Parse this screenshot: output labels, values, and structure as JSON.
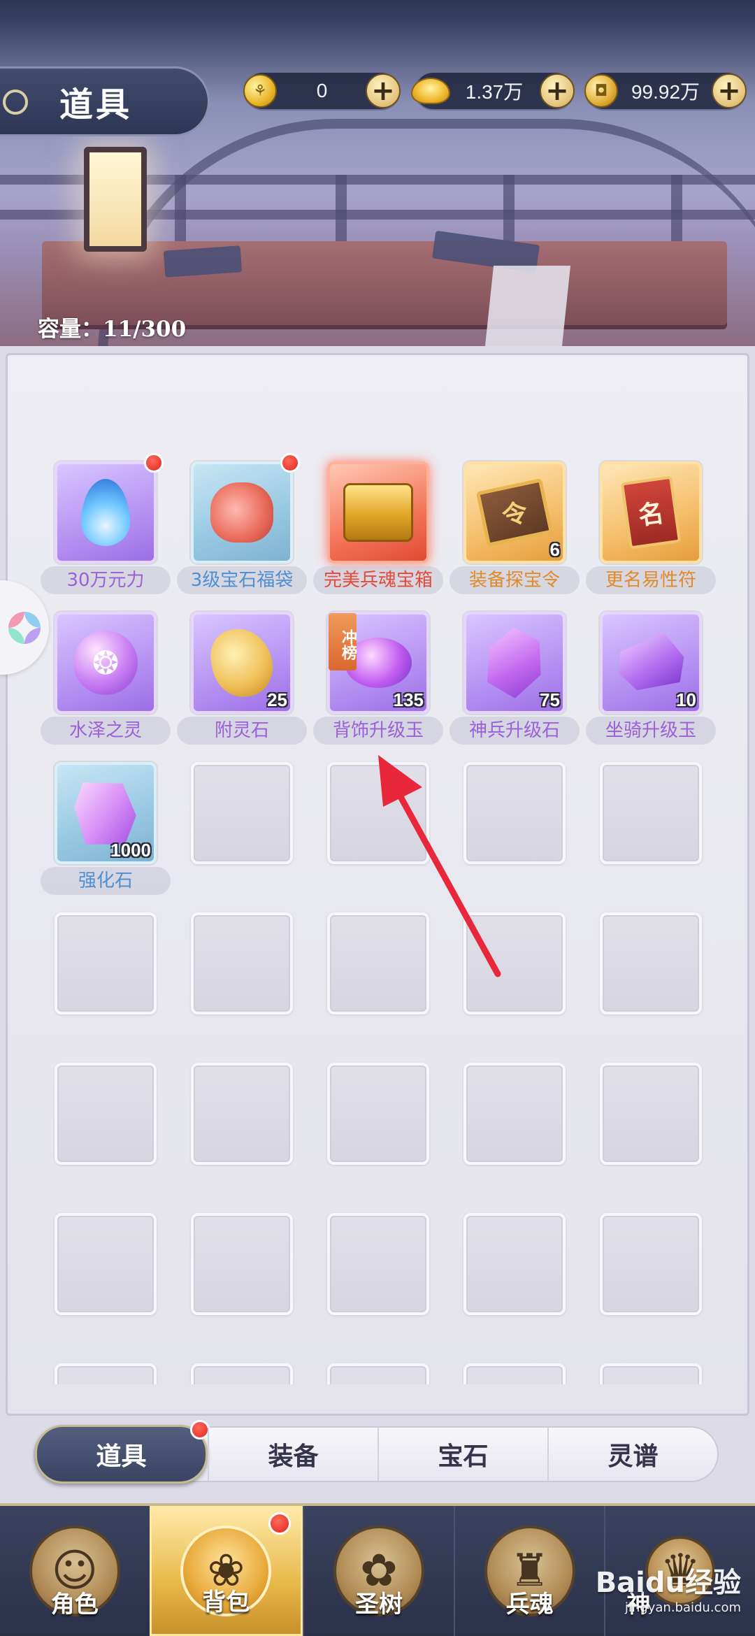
{
  "header": {
    "title": "道具",
    "currencies": [
      {
        "icon": "gold-coin-icon",
        "value": "0"
      },
      {
        "icon": "gold-ingot-icon",
        "value": "1.37万"
      },
      {
        "icon": "copper-coin-icon",
        "value": "99.92万"
      }
    ],
    "capacity": "容量：11/300"
  },
  "items": [
    {
      "name": "30万元力",
      "quality": "purple",
      "count": "",
      "badge": true,
      "tag": ""
    },
    {
      "name": "3级宝石福袋",
      "quality": "blue",
      "count": "",
      "badge": true,
      "tag": ""
    },
    {
      "name": "完美兵魂宝箱",
      "quality": "red",
      "count": "",
      "badge": false,
      "tag": ""
    },
    {
      "name": "装备探宝令",
      "quality": "orange",
      "count": "6",
      "badge": false,
      "tag": ""
    },
    {
      "name": "更名易性符",
      "quality": "orange",
      "count": "",
      "badge": false,
      "tag": ""
    },
    {
      "name": "水泽之灵",
      "quality": "purple",
      "count": "",
      "badge": false,
      "tag": ""
    },
    {
      "name": "附灵石",
      "quality": "purple",
      "count": "25",
      "badge": false,
      "tag": ""
    },
    {
      "name": "背饰升级玉",
      "quality": "purple",
      "count": "135",
      "badge": false,
      "tag": "冲榜"
    },
    {
      "name": "神兵升级石",
      "quality": "purple",
      "count": "75",
      "badge": false,
      "tag": ""
    },
    {
      "name": "坐骑升级玉",
      "quality": "purple",
      "count": "10",
      "badge": false,
      "tag": ""
    },
    {
      "name": "强化石",
      "quality": "blue",
      "count": "1000",
      "badge": false,
      "tag": ""
    }
  ],
  "glyphs": {
    "token": "令",
    "card": "名",
    "orb": "❂",
    "plus": "+"
  },
  "tabs": [
    {
      "label": "道具",
      "active": true,
      "badge": true
    },
    {
      "label": "装备",
      "active": false,
      "badge": false
    },
    {
      "label": "宝石",
      "active": false,
      "badge": false
    },
    {
      "label": "灵谱",
      "active": false,
      "badge": false
    }
  ],
  "nav": [
    {
      "label": "角色",
      "icon": "character-icon",
      "active": false,
      "badge": false
    },
    {
      "label": "背包",
      "icon": "bag-icon",
      "active": true,
      "badge": true
    },
    {
      "label": "圣树",
      "icon": "sacred-tree-icon",
      "active": false,
      "badge": false
    },
    {
      "label": "兵魂",
      "icon": "weapon-soul-icon",
      "active": false,
      "badge": false
    },
    {
      "label": "神",
      "icon": "deity-icon",
      "active": false,
      "badge": false
    }
  ],
  "watermark": {
    "main": "Baidu经验",
    "sub": "jingyan.baidu.com"
  }
}
